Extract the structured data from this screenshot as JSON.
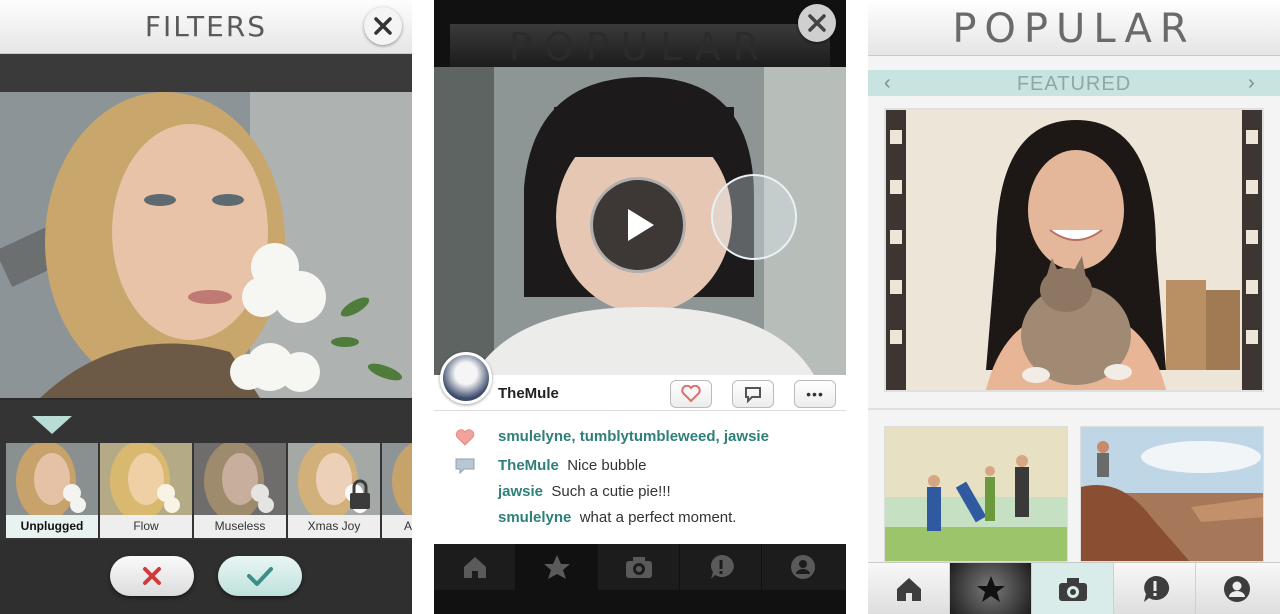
{
  "filters_screen": {
    "title": "FILTERS",
    "close_label": "close",
    "filters": [
      {
        "label": "Unplugged",
        "selected": true
      },
      {
        "label": "Flow",
        "selected": false
      },
      {
        "label": "Museless",
        "selected": false
      },
      {
        "label": "Xmas Joy",
        "selected": false,
        "locked": true
      },
      {
        "label": "A",
        "selected": false
      }
    ],
    "cancel_icon": "x-icon",
    "confirm_icon": "check-icon"
  },
  "detail_screen": {
    "title": "POPULAR",
    "username": "TheMule",
    "likes_line": "smulelyne, tumblytumbleweed, jawsie",
    "comments": [
      {
        "user": "TheMule",
        "text": "Nice bubble"
      },
      {
        "user": "jawsie",
        "text": "Such a cutie pie!!!"
      },
      {
        "user": "smulelyne",
        "text": "what a perfect moment."
      }
    ],
    "more_label": "•••"
  },
  "popular_screen": {
    "title": "POPULAR",
    "featured_label": "FEATURED",
    "prev_arrow": "‹",
    "next_arrow": "›"
  },
  "tabs": [
    "home-icon",
    "star-icon",
    "camera-icon",
    "comment-icon",
    "profile-icon"
  ],
  "colors": {
    "accent": "#2f7f7a",
    "featured_bar": "#c8e4e0",
    "cancel_red": "#d23b3b",
    "confirm_teal": "#3b8f88"
  }
}
